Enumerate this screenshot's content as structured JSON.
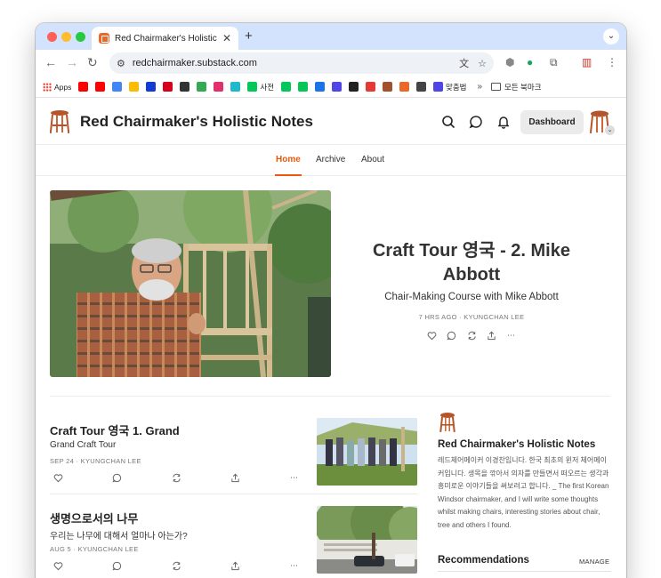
{
  "browser": {
    "tab_title": "Red Chairmaker's Holistic No",
    "tab_close": "✕",
    "new_tab": "+",
    "url": "redchairmaker.substack.com",
    "bookmarks": [
      {
        "label": "Apps",
        "icon": "apps-grid-icon",
        "color": "#ea4335"
      },
      {
        "label": "",
        "icon": "youtube-icon",
        "color": "#ff0000"
      },
      {
        "label": "",
        "icon": "youtube-music-icon",
        "color": "#ff0000"
      },
      {
        "label": "",
        "icon": "google-icon",
        "color": "#4285f4"
      },
      {
        "label": "",
        "icon": "keep-icon",
        "color": "#fbbc04"
      },
      {
        "label": "",
        "icon": "disney-icon",
        "color": "#113ccf"
      },
      {
        "label": "",
        "icon": "m-icon",
        "color": "#d6001c"
      },
      {
        "label": "",
        "icon": "dark-app-icon",
        "color": "#333333"
      },
      {
        "label": "",
        "icon": "play-icon",
        "color": "#34a853"
      },
      {
        "label": "",
        "icon": "instagram-icon",
        "color": "#e1306c"
      },
      {
        "label": "",
        "icon": "perplexity-icon",
        "color": "#20b8cd"
      },
      {
        "label": "사전",
        "icon": "naver-dict-icon",
        "color": "#03c75a"
      },
      {
        "label": "",
        "icon": "naver-icon",
        "color": "#03c75a"
      },
      {
        "label": "",
        "icon": "line-icon",
        "color": "#06c755"
      },
      {
        "label": "",
        "icon": "blue-app-icon",
        "color": "#1a73e8"
      },
      {
        "label": "",
        "icon": "d-icon",
        "color": "#4f46e5"
      },
      {
        "label": "",
        "icon": "dots-icon",
        "color": "#222222"
      },
      {
        "label": "",
        "icon": "red-app-icon",
        "color": "#e53935"
      },
      {
        "label": "",
        "icon": "brown-app-icon",
        "color": "#a0522d"
      },
      {
        "label": "",
        "icon": "substack-icon",
        "color": "#e8692a"
      },
      {
        "label": "",
        "icon": "chatgpt-icon",
        "color": "#444444"
      },
      {
        "label": "맞춤법",
        "icon": "spellcheck-icon",
        "color": "#4f46e5"
      }
    ],
    "more_bookmarks": "»",
    "all_bookmarks": "모든 북마크"
  },
  "site": {
    "title": "Red Chairmaker's Holistic Notes",
    "dashboard_label": "Dashboard",
    "accent_color": "#e8590c"
  },
  "nav": {
    "home": "Home",
    "archive": "Archive",
    "about": "About"
  },
  "hero": {
    "title": "Craft Tour 영국 - 2. Mike Abbott",
    "subtitle": "Chair-Making Course with Mike Abbott",
    "meta": "7 HRS AGO · KYUNGCHAN LEE"
  },
  "posts": [
    {
      "title": "Craft Tour 영국 1. Grand",
      "subtitle": "Grand Craft Tour",
      "meta": "SEP 24 · KYUNGCHAN LEE"
    },
    {
      "title": "생명으로서의 나무",
      "subtitle": "우리는 나무에 대해서 얼마나 아는가?",
      "meta": "AUG 5 · KYUNGCHAN LEE"
    }
  ],
  "sidebar": {
    "title": "Red Chairmaker's Holistic Notes",
    "description": "레드체어메이커 이경찬입니다. 한국 최초의 윈저 체어메이커입니다. 생목을 깎아서 의자를 만들면서 떠오르는 생각과 흥미로운 이야기들을 써보려고 합니다. _ The first Korean Windsor chairmaker, and I will write some thoughts whilst making chairs, interesting stories about chair, tree and others I found.",
    "recommendations": "Recommendations",
    "manage": "MANAGE"
  }
}
